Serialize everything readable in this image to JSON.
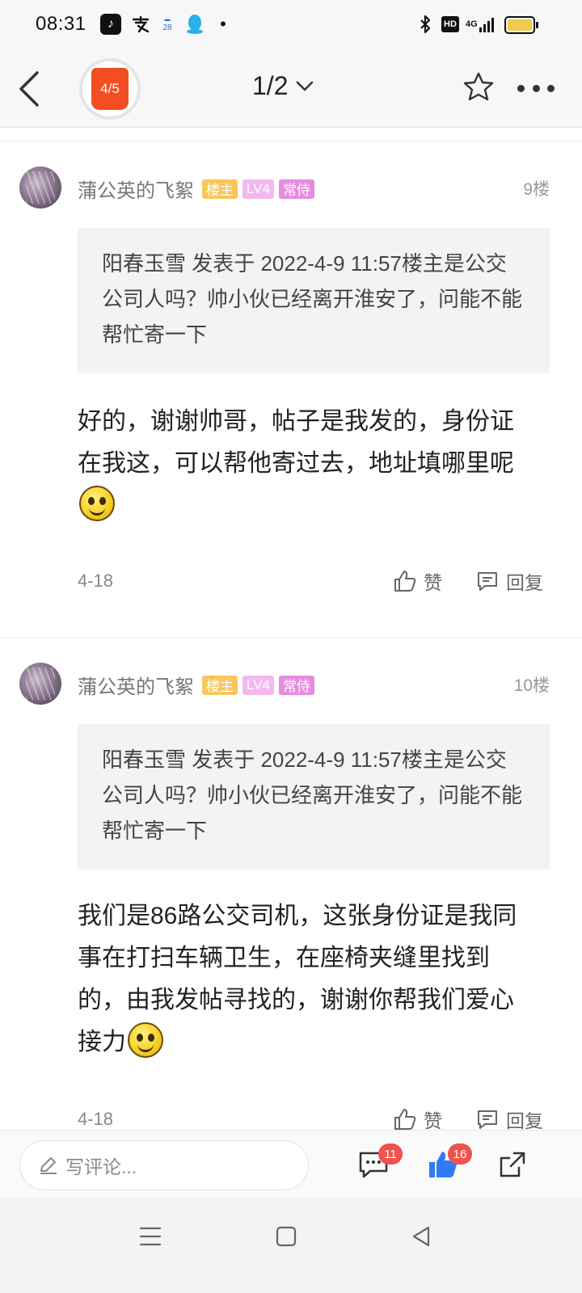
{
  "status_bar": {
    "time": "08:31",
    "calendar_day": "28",
    "hd_label": "HD",
    "network_label": "4G"
  },
  "nav": {
    "badge_text": "4/5",
    "page_indicator": "1/2"
  },
  "posts": [
    {
      "author": "蒲公英的飞絮",
      "badges": [
        "楼主",
        "LV4",
        "常侍"
      ],
      "floor": "9楼",
      "quote": "阳春玉雪 发表于 2022-4-9 11:57楼主是公交公司人吗？帅小伙已经离开淮安了，问能不能帮忙寄一下",
      "body": "好的，谢谢帅哥，帖子是我发的，身份证在我这，可以帮他寄过去，地址填哪里呢",
      "date": "4-18",
      "like_label": "赞",
      "reply_label": "回复"
    },
    {
      "author": "蒲公英的飞絮",
      "badges": [
        "楼主",
        "LV4",
        "常侍"
      ],
      "floor": "10楼",
      "quote": "阳春玉雪 发表于 2022-4-9 11:57楼主是公交公司人吗？帅小伙已经离开淮安了，问能不能帮忙寄一下",
      "body": "我们是86路公交司机，这张身份证是我同事在打扫车辆卫生，在座椅夹缝里找到的，由我发帖寻找的，谢谢你帮我们爱心接力",
      "date": "4-18",
      "like_label": "赞",
      "reply_label": "回复"
    }
  ],
  "comment_bar": {
    "placeholder": "写评论...",
    "comment_count": "11",
    "like_count": "16"
  },
  "colors": {
    "accent_red": "#f24e22",
    "badge_red": "#f0524d",
    "like_blue": "#2f7bf5"
  }
}
